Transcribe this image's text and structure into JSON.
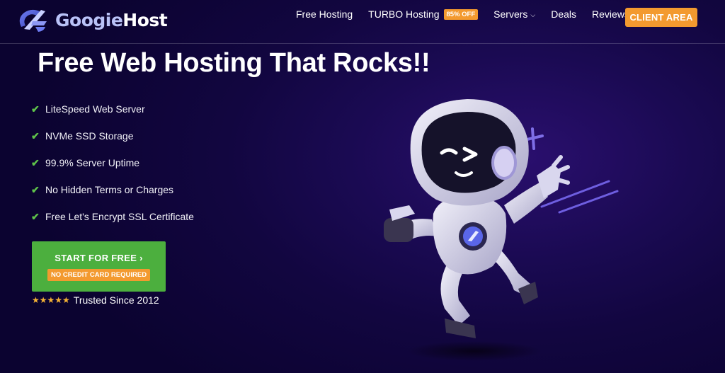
{
  "brand": {
    "name_part1": "Googie",
    "name_part2": "Host",
    "logo_icon": "googiehost-logo-icon"
  },
  "nav": {
    "free_hosting": "Free Hosting",
    "turbo_hosting": "TURBO Hosting",
    "turbo_badge": "85% OFF",
    "servers": "Servers",
    "deals": "Deals",
    "reviews": "Reviews",
    "chevron_icon": "chevron-down-icon",
    "client_area": "CLIENT AREA"
  },
  "hero": {
    "title": "Free Web Hosting That Rocks!!",
    "features": [
      "LiteSpeed Web Server",
      "NVMe SSD Storage",
      "99.9% Server Uptime",
      "No Hidden Terms or Charges",
      "Free Let's Encrypt SSL Certificate"
    ],
    "feature_icon": "check-icon",
    "cta_label": "START FOR FREE",
    "cta_sub": "NO CREDIT CARD REQUIRED",
    "rating_stars": 5,
    "trusted_text": "Trusted Since 2012"
  },
  "illustration": "astronaut-mascot",
  "colors": {
    "accent_orange": "#f39a2f",
    "cta_green": "#4caf3e",
    "check_green": "#5fc44a",
    "background_dark": "#120640",
    "star_gold": "#f5b335"
  }
}
